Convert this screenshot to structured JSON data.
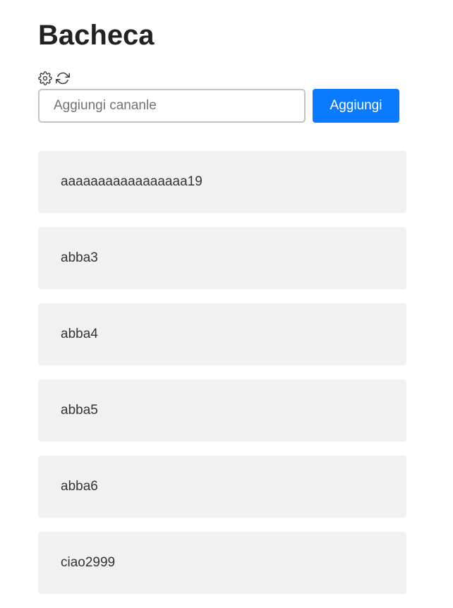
{
  "header": {
    "title": "Bacheca"
  },
  "toolbar": {
    "icons": [
      "gear-icon",
      "refresh-icon"
    ]
  },
  "add_channel": {
    "input_value": "",
    "input_placeholder": "Aggiungi cananle",
    "button_label": "Aggiungi"
  },
  "channels": [
    {
      "name": "aaaaaaaaaaaaaaaaa19"
    },
    {
      "name": "abba3"
    },
    {
      "name": "abba4"
    },
    {
      "name": "abba5"
    },
    {
      "name": "abba6"
    },
    {
      "name": "ciao2999"
    }
  ],
  "colors": {
    "accent": "#0a7aff",
    "card_background": "#f1f1f1",
    "input_border": "#c4c4c4"
  }
}
